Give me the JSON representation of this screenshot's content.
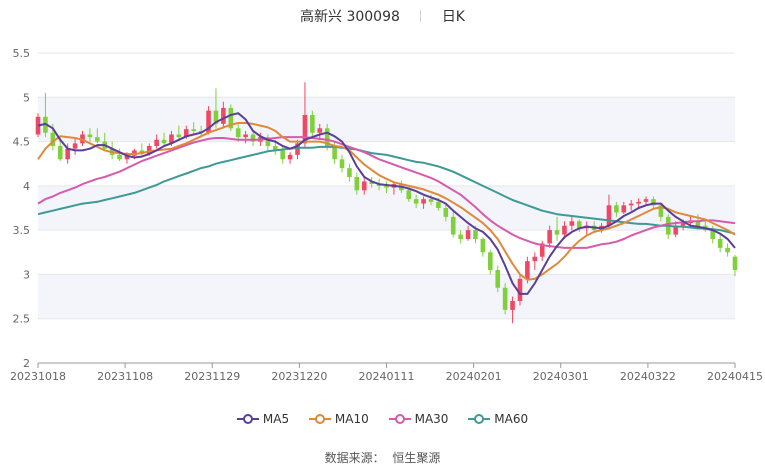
{
  "header": {
    "title": "高新兴 300098",
    "period": "日K"
  },
  "footer": {
    "source_label": "数据来源：",
    "source_name": "恒生聚源"
  },
  "colors": {
    "up": "#f04864",
    "down": "#7fd13b",
    "grid": "#e6e6e6",
    "band": "#f3f5fa",
    "ma5": "#5a3f99",
    "ma10": "#e0893a",
    "ma30": "#d65aad",
    "ma60": "#3f9a96"
  },
  "chart_data": {
    "type": "candlestick",
    "ylim": [
      2,
      5.5
    ],
    "yticks": [
      "2",
      "2.5",
      "3",
      "3.5",
      "4",
      "4.5",
      "5",
      "5.5"
    ],
    "xticks": [
      "20231018",
      "20231108",
      "20231129",
      "20231220",
      "20240111",
      "20240201",
      "20240301",
      "20240322",
      "20240415"
    ],
    "series_names": [
      "MA5",
      "MA10",
      "MA30",
      "MA60"
    ],
    "ohlc": [
      [
        4.58,
        4.82,
        4.55,
        4.78
      ],
      [
        4.78,
        5.05,
        4.55,
        4.6
      ],
      [
        4.6,
        4.7,
        4.4,
        4.45
      ],
      [
        4.45,
        4.55,
        4.28,
        4.3
      ],
      [
        4.3,
        4.48,
        4.25,
        4.42
      ],
      [
        4.42,
        4.55,
        4.35,
        4.48
      ],
      [
        4.48,
        4.62,
        4.45,
        4.58
      ],
      [
        4.58,
        4.65,
        4.5,
        4.55
      ],
      [
        4.55,
        4.65,
        4.48,
        4.5
      ],
      [
        4.5,
        4.6,
        4.4,
        4.42
      ],
      [
        4.42,
        4.5,
        4.3,
        4.35
      ],
      [
        4.35,
        4.42,
        4.28,
        4.3
      ],
      [
        4.3,
        4.38,
        4.25,
        4.34
      ],
      [
        4.34,
        4.42,
        4.3,
        4.4
      ],
      [
        4.4,
        4.48,
        4.33,
        4.36
      ],
      [
        4.36,
        4.48,
        4.34,
        4.45
      ],
      [
        4.45,
        4.58,
        4.42,
        4.52
      ],
      [
        4.52,
        4.6,
        4.46,
        4.48
      ],
      [
        4.48,
        4.62,
        4.45,
        4.58
      ],
      [
        4.58,
        4.68,
        4.52,
        4.55
      ],
      [
        4.55,
        4.68,
        4.53,
        4.64
      ],
      [
        4.64,
        4.72,
        4.57,
        4.62
      ],
      [
        4.62,
        4.68,
        4.55,
        4.6
      ],
      [
        4.6,
        4.9,
        4.58,
        4.85
      ],
      [
        4.85,
        5.1,
        4.65,
        4.7
      ],
      [
        4.7,
        4.95,
        4.65,
        4.88
      ],
      [
        4.88,
        4.92,
        4.62,
        4.65
      ],
      [
        4.65,
        4.7,
        4.5,
        4.55
      ],
      [
        4.55,
        4.62,
        4.48,
        4.58
      ],
      [
        4.58,
        4.62,
        4.45,
        4.5
      ],
      [
        4.5,
        4.6,
        4.45,
        4.55
      ],
      [
        4.55,
        4.58,
        4.4,
        4.45
      ],
      [
        4.45,
        4.52,
        4.35,
        4.4
      ],
      [
        4.4,
        4.45,
        4.25,
        4.3
      ],
      [
        4.3,
        4.38,
        4.25,
        4.35
      ],
      [
        4.35,
        4.52,
        4.3,
        4.48
      ],
      [
        4.48,
        5.17,
        4.42,
        4.8
      ],
      [
        4.8,
        4.85,
        4.55,
        4.6
      ],
      [
        4.6,
        4.7,
        4.52,
        4.65
      ],
      [
        4.65,
        4.7,
        4.4,
        4.45
      ],
      [
        4.45,
        4.5,
        4.25,
        4.3
      ],
      [
        4.3,
        4.35,
        4.15,
        4.2
      ],
      [
        4.2,
        4.25,
        4.05,
        4.1
      ],
      [
        4.1,
        4.15,
        3.9,
        3.95
      ],
      [
        3.95,
        4.1,
        3.9,
        4.05
      ],
      [
        4.05,
        4.1,
        3.98,
        4.02
      ],
      [
        4.02,
        4.08,
        3.95,
        4.0
      ],
      [
        4.0,
        4.05,
        3.92,
        3.98
      ],
      [
        3.98,
        4.05,
        3.9,
        4.02
      ],
      [
        4.02,
        4.06,
        3.92,
        3.95
      ],
      [
        3.95,
        3.98,
        3.82,
        3.85
      ],
      [
        3.85,
        3.9,
        3.75,
        3.8
      ],
      [
        3.8,
        3.88,
        3.74,
        3.85
      ],
      [
        3.85,
        3.9,
        3.78,
        3.82
      ],
      [
        3.82,
        3.86,
        3.72,
        3.75
      ],
      [
        3.75,
        3.8,
        3.6,
        3.65
      ],
      [
        3.65,
        3.7,
        3.42,
        3.45
      ],
      [
        3.45,
        3.5,
        3.35,
        3.4
      ],
      [
        3.4,
        3.55,
        3.38,
        3.5
      ],
      [
        3.5,
        3.55,
        3.35,
        3.4
      ],
      [
        3.4,
        3.42,
        3.2,
        3.25
      ],
      [
        3.25,
        3.28,
        3.0,
        3.05
      ],
      [
        3.05,
        3.1,
        2.8,
        2.85
      ],
      [
        2.85,
        2.9,
        2.55,
        2.6
      ],
      [
        2.6,
        2.75,
        2.45,
        2.7
      ],
      [
        2.7,
        3.0,
        2.65,
        2.95
      ],
      [
        2.95,
        3.2,
        2.9,
        3.15
      ],
      [
        3.15,
        3.25,
        3.05,
        3.2
      ],
      [
        3.2,
        3.38,
        3.15,
        3.35
      ],
      [
        3.35,
        3.55,
        3.3,
        3.5
      ],
      [
        3.5,
        3.65,
        3.38,
        3.45
      ],
      [
        3.45,
        3.6,
        3.4,
        3.55
      ],
      [
        3.55,
        3.65,
        3.5,
        3.6
      ],
      [
        3.6,
        3.62,
        3.48,
        3.52
      ],
      [
        3.52,
        3.6,
        3.45,
        3.55
      ],
      [
        3.55,
        3.6,
        3.48,
        3.5
      ],
      [
        3.5,
        3.58,
        3.47,
        3.55
      ],
      [
        3.55,
        3.9,
        3.52,
        3.78
      ],
      [
        3.78,
        3.82,
        3.65,
        3.7
      ],
      [
        3.7,
        3.82,
        3.68,
        3.78
      ],
      [
        3.78,
        3.84,
        3.72,
        3.8
      ],
      [
        3.8,
        3.86,
        3.74,
        3.82
      ],
      [
        3.82,
        3.88,
        3.78,
        3.85
      ],
      [
        3.85,
        3.88,
        3.75,
        3.78
      ],
      [
        3.78,
        3.8,
        3.6,
        3.65
      ],
      [
        3.65,
        3.68,
        3.4,
        3.45
      ],
      [
        3.45,
        3.6,
        3.42,
        3.55
      ],
      [
        3.55,
        3.62,
        3.5,
        3.58
      ],
      [
        3.58,
        3.65,
        3.52,
        3.6
      ],
      [
        3.6,
        3.68,
        3.52,
        3.55
      ],
      [
        3.55,
        3.6,
        3.48,
        3.5
      ],
      [
        3.5,
        3.55,
        3.35,
        3.4
      ],
      [
        3.4,
        3.45,
        3.25,
        3.3
      ],
      [
        3.3,
        3.35,
        3.2,
        3.25
      ],
      [
        3.2,
        3.22,
        2.98,
        3.05
      ]
    ],
    "ma5": [
      4.68,
      4.7,
      4.65,
      4.52,
      4.42,
      4.4,
      4.4,
      4.42,
      4.46,
      4.46,
      4.42,
      4.38,
      4.34,
      4.32,
      4.33,
      4.36,
      4.4,
      4.45,
      4.48,
      4.52,
      4.56,
      4.58,
      4.6,
      4.65,
      4.72,
      4.76,
      4.8,
      4.82,
      4.75,
      4.62,
      4.56,
      4.52,
      4.5,
      4.45,
      4.42,
      4.45,
      4.52,
      4.55,
      4.58,
      4.6,
      4.56,
      4.5,
      4.38,
      4.22,
      4.1,
      4.05,
      4.02,
      4.01,
      4.0,
      3.99,
      3.97,
      3.94,
      3.9,
      3.87,
      3.84,
      3.8,
      3.72,
      3.65,
      3.58,
      3.52,
      3.48,
      3.4,
      3.28,
      3.1,
      2.9,
      2.78,
      2.78,
      2.9,
      3.05,
      3.2,
      3.32,
      3.42,
      3.48,
      3.52,
      3.54,
      3.53,
      3.52,
      3.55,
      3.6,
      3.66,
      3.7,
      3.75,
      3.78,
      3.8,
      3.8,
      3.72,
      3.65,
      3.6,
      3.55,
      3.54,
      3.52,
      3.5,
      3.46,
      3.4,
      3.3
    ],
    "ma10": [
      4.3,
      4.42,
      4.5,
      4.56,
      4.55,
      4.54,
      4.52,
      4.48,
      4.44,
      4.4,
      4.38,
      4.37,
      4.36,
      4.36,
      4.37,
      4.39,
      4.4,
      4.41,
      4.42,
      4.45,
      4.48,
      4.52,
      4.56,
      4.6,
      4.63,
      4.66,
      4.69,
      4.71,
      4.71,
      4.7,
      4.68,
      4.66,
      4.62,
      4.55,
      4.5,
      4.5,
      4.5,
      4.5,
      4.5,
      4.48,
      4.45,
      4.44,
      4.4,
      4.32,
      4.24,
      4.18,
      4.12,
      4.08,
      4.04,
      4.02,
      4.0,
      3.98,
      3.96,
      3.93,
      3.9,
      3.86,
      3.81,
      3.76,
      3.7,
      3.64,
      3.58,
      3.5,
      3.4,
      3.26,
      3.12,
      3.0,
      2.94,
      2.95,
      3.0,
      3.06,
      3.12,
      3.2,
      3.3,
      3.38,
      3.44,
      3.48,
      3.5,
      3.52,
      3.55,
      3.58,
      3.62,
      3.66,
      3.7,
      3.74,
      3.76,
      3.74,
      3.7,
      3.68,
      3.66,
      3.64,
      3.62,
      3.58,
      3.54,
      3.5,
      3.45
    ],
    "ma30": [
      3.8,
      3.85,
      3.88,
      3.92,
      3.95,
      3.98,
      4.02,
      4.05,
      4.08,
      4.1,
      4.13,
      4.16,
      4.2,
      4.24,
      4.28,
      4.31,
      4.34,
      4.37,
      4.4,
      4.43,
      4.46,
      4.49,
      4.51,
      4.53,
      4.54,
      4.54,
      4.53,
      4.52,
      4.52,
      4.52,
      4.52,
      4.53,
      4.54,
      4.55,
      4.55,
      4.55,
      4.55,
      4.54,
      4.53,
      4.52,
      4.5,
      4.47,
      4.44,
      4.41,
      4.38,
      4.34,
      4.3,
      4.27,
      4.24,
      4.21,
      4.18,
      4.15,
      4.12,
      4.09,
      4.05,
      4.0,
      3.95,
      3.9,
      3.83,
      3.76,
      3.68,
      3.61,
      3.55,
      3.5,
      3.45,
      3.41,
      3.38,
      3.35,
      3.33,
      3.32,
      3.31,
      3.3,
      3.3,
      3.3,
      3.3,
      3.32,
      3.34,
      3.35,
      3.37,
      3.4,
      3.44,
      3.47,
      3.5,
      3.53,
      3.55,
      3.57,
      3.58,
      3.59,
      3.6,
      3.6,
      3.61,
      3.61,
      3.6,
      3.59,
      3.58
    ],
    "ma60": [
      3.68,
      3.7,
      3.72,
      3.74,
      3.76,
      3.78,
      3.8,
      3.81,
      3.82,
      3.84,
      3.86,
      3.88,
      3.9,
      3.92,
      3.95,
      3.98,
      4.01,
      4.05,
      4.08,
      4.11,
      4.14,
      4.17,
      4.2,
      4.22,
      4.25,
      4.27,
      4.29,
      4.31,
      4.33,
      4.35,
      4.37,
      4.39,
      4.4,
      4.41,
      4.42,
      4.43,
      4.43,
      4.43,
      4.44,
      4.44,
      4.44,
      4.43,
      4.42,
      4.41,
      4.39,
      4.37,
      4.36,
      4.35,
      4.33,
      4.31,
      4.29,
      4.27,
      4.26,
      4.24,
      4.22,
      4.19,
      4.16,
      4.12,
      4.08,
      4.04,
      4.0,
      3.96,
      3.92,
      3.88,
      3.84,
      3.81,
      3.78,
      3.75,
      3.72,
      3.7,
      3.68,
      3.67,
      3.66,
      3.65,
      3.64,
      3.63,
      3.62,
      3.61,
      3.6,
      3.59,
      3.58,
      3.57,
      3.57,
      3.56,
      3.55,
      3.55,
      3.54,
      3.54,
      3.53,
      3.52,
      3.52,
      3.51,
      3.5,
      3.48,
      3.46
    ]
  }
}
